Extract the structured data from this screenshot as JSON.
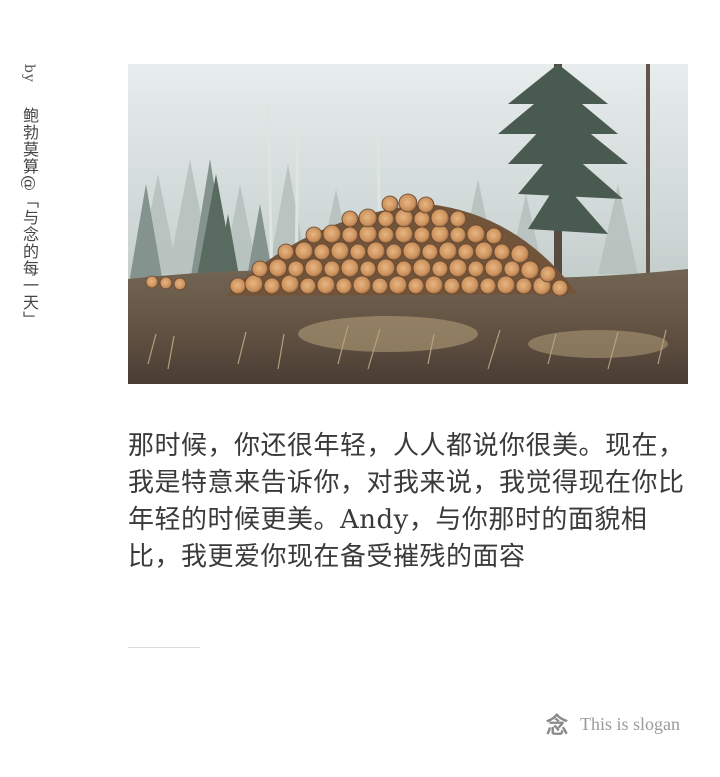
{
  "credit": {
    "by": "by",
    "author": "鲍勃莫算@「与念的每一天」"
  },
  "photo": {
    "alt_subject": "pile-of-logs-in-misty-forest"
  },
  "quote": {
    "text": "那时候，你还很年轻，人人都说你很美。现在，我是特意来告诉你，对我来说，我觉得现在你比年轻的时候更美。Andy，与你那时的面貌相比，我更爱你现在备受摧残的面容"
  },
  "footer": {
    "mark_glyph": "念",
    "slogan": "This is slogan"
  },
  "colors": {
    "text": "#3a3a3a",
    "muted": "#9a9a9a",
    "divider": "#dcdcdc"
  }
}
